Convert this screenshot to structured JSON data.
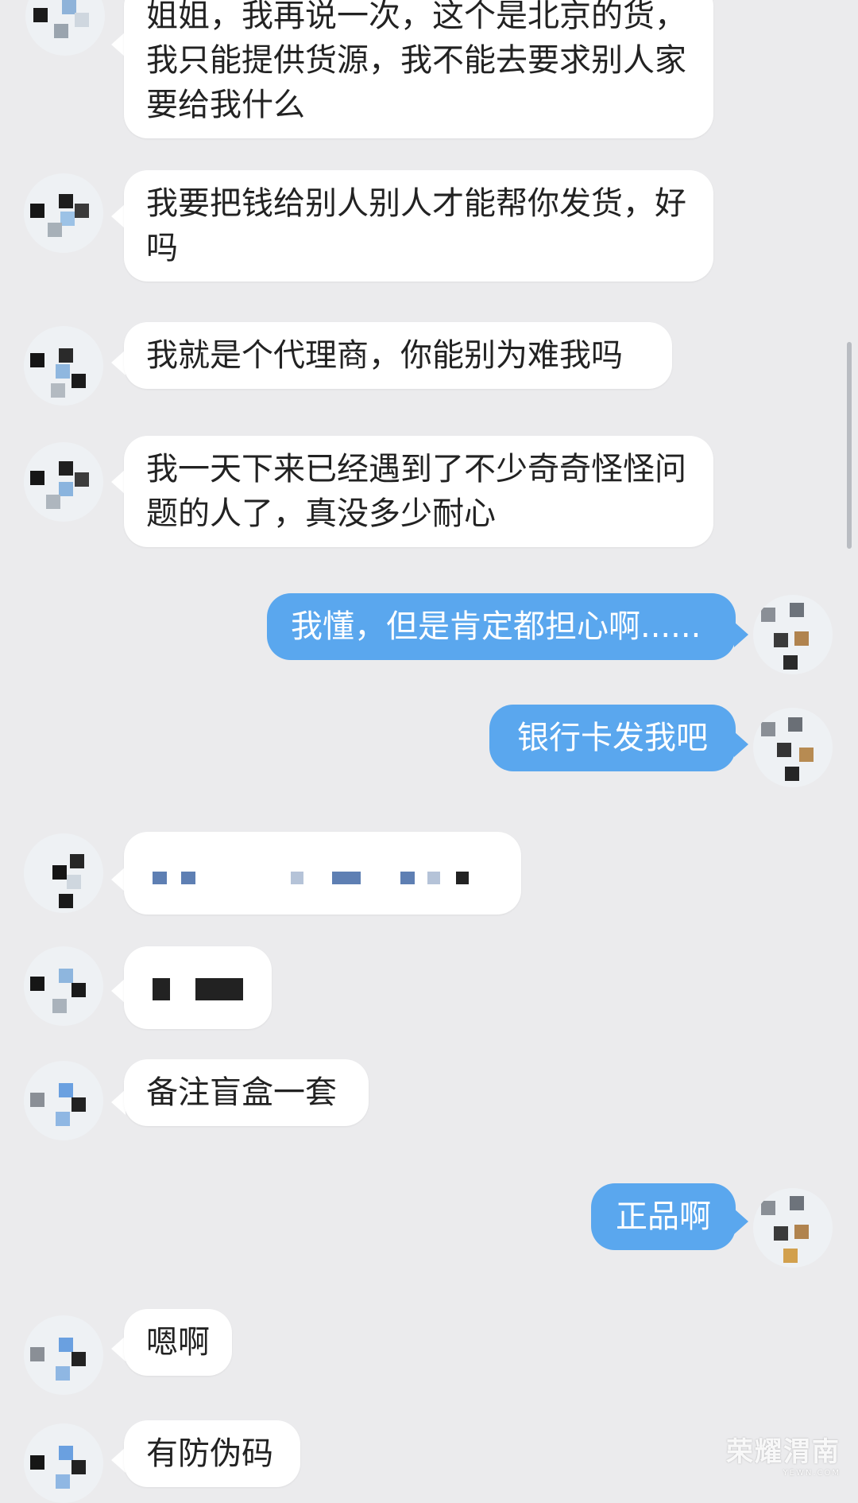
{
  "messages": [
    {
      "side": "left",
      "text": "姐姐，我再说一次，这个是北京的货，我只能提供货源，我不能去要求别人家要给我什么"
    },
    {
      "side": "left",
      "text": "我要把钱给别人别人才能帮你发货，好吗"
    },
    {
      "side": "left",
      "text": "我就是个代理商，你能别为难我吗"
    },
    {
      "side": "left",
      "text": "我一天下来已经遇到了不少奇奇怪怪问题的人了，真没多少耐心"
    },
    {
      "side": "right",
      "text": "我懂，但是肯定都担心啊......"
    },
    {
      "side": "right",
      "text": "银行卡发我吧"
    },
    {
      "side": "left",
      "text": "",
      "redacted": true
    },
    {
      "side": "left",
      "text": "",
      "redacted": true
    },
    {
      "side": "left",
      "text": "备注盲盒一套"
    },
    {
      "side": "right",
      "text": "正品啊"
    },
    {
      "side": "left",
      "text": "嗯啊"
    },
    {
      "side": "left",
      "text": "有防伪码"
    }
  ],
  "watermark": {
    "main": "荣耀渭南",
    "sub": "YEWN.COM"
  },
  "colors": {
    "background": "#ebebed",
    "left_bubble": "#ffffff",
    "right_bubble": "#5aa7ee"
  }
}
